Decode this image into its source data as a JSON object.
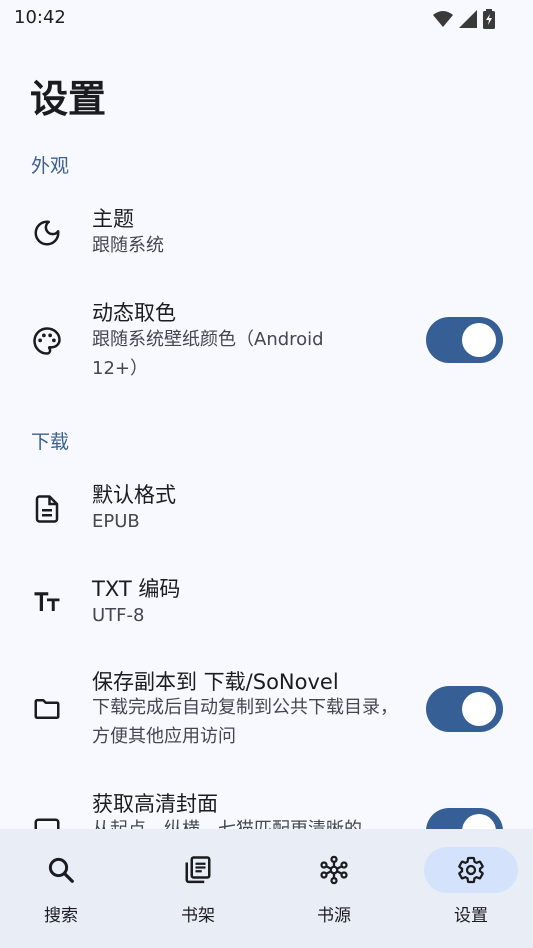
{
  "status": {
    "time": "10:42"
  },
  "page": {
    "title": "设置"
  },
  "sections": {
    "appearance": "外观",
    "download": "下载"
  },
  "settings": {
    "theme": {
      "title": "主题",
      "subtitle": "跟随系统"
    },
    "dynamic_color": {
      "title": "动态取色",
      "subtitle": "跟随系统壁纸颜色（Android 12+）",
      "enabled": true
    },
    "default_format": {
      "title": "默认格式",
      "subtitle": "EPUB"
    },
    "txt_encoding": {
      "title": "TXT 编码",
      "subtitle": "UTF-8"
    },
    "save_copy": {
      "title": "保存副本到 下载/SoNovel",
      "subtitle": "下载完成后自动复制到公共下载目录，方便其他应用访问",
      "enabled": true
    },
    "hd_cover": {
      "title": "获取高清封面",
      "subtitle": "从起点、纵横、七猫匹配更清晰的",
      "enabled": true
    }
  },
  "nav": {
    "items": [
      {
        "label": "搜索",
        "icon": "search-icon"
      },
      {
        "label": "书架",
        "icon": "bookshelf-icon"
      },
      {
        "label": "书源",
        "icon": "hub-icon"
      },
      {
        "label": "设置",
        "icon": "gear-icon"
      }
    ],
    "active": "设置"
  },
  "colors": {
    "accent": "#355f95",
    "section": "#3b5f8f",
    "nav_bg": "#e9edf6",
    "active_pill": "#d4e3fb"
  }
}
